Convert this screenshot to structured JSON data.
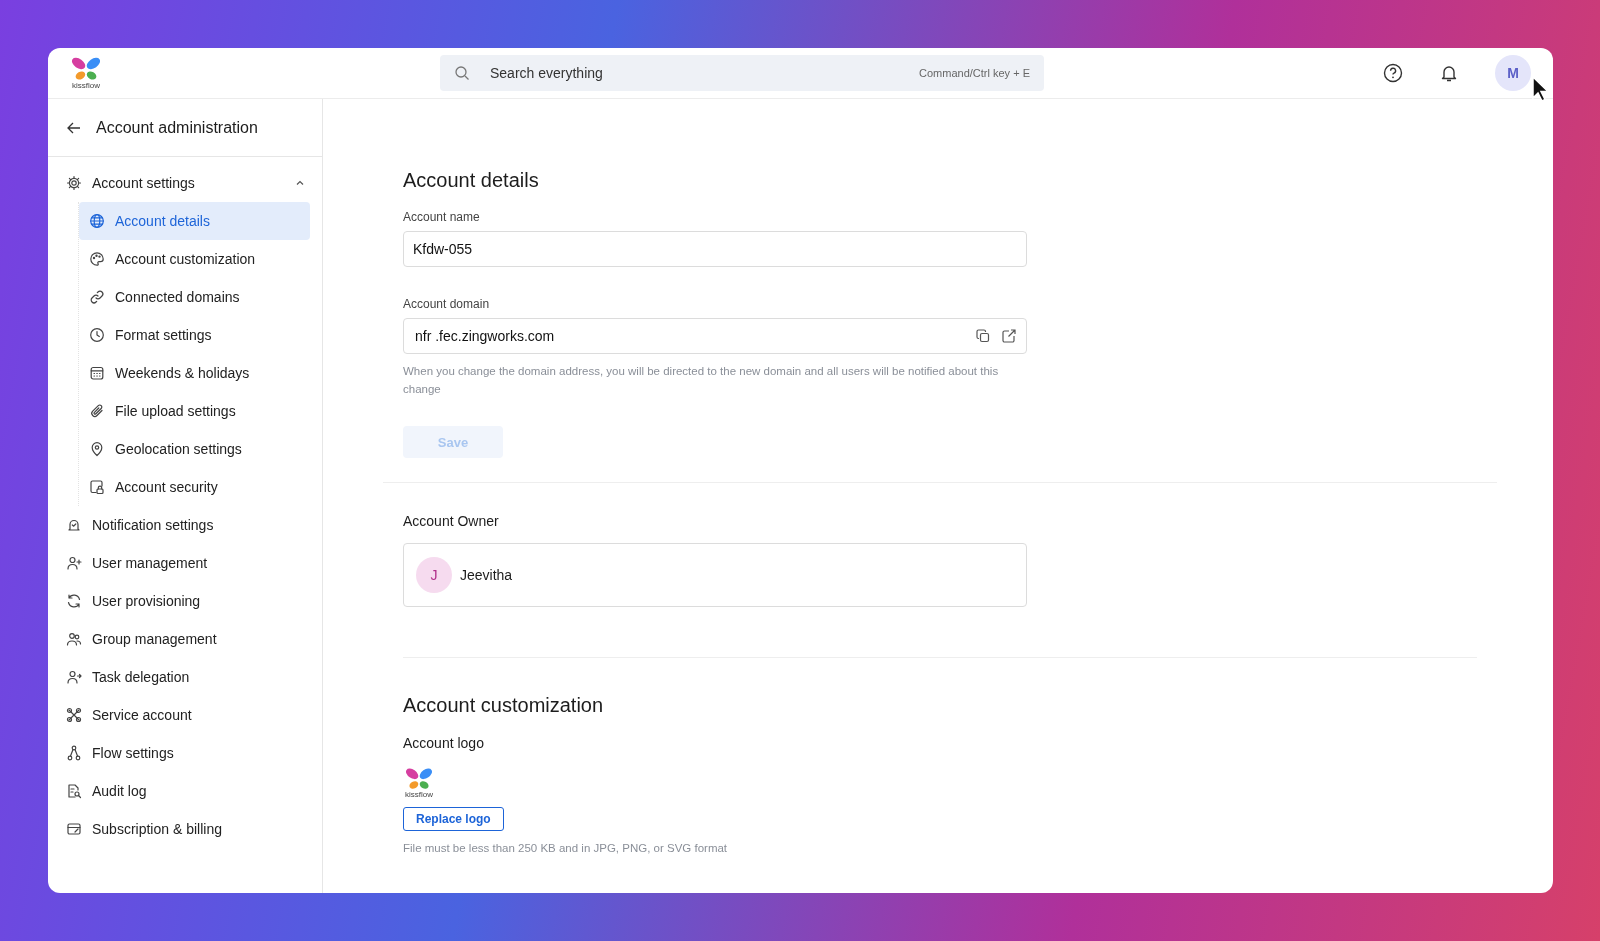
{
  "header": {
    "logo_text": "kissflow",
    "search": {
      "placeholder": "Search everything",
      "shortcut": "Command/Ctrl key + E"
    },
    "avatar": "M"
  },
  "sidebar": {
    "title": "Account administration",
    "items": [
      {
        "label": "Account settings",
        "selected": false,
        "expanded": true,
        "children": [
          {
            "label": "Account details",
            "selected": true
          },
          {
            "label": "Account customization",
            "selected": false
          },
          {
            "label": "Connected domains",
            "selected": false
          },
          {
            "label": "Format settings",
            "selected": false
          },
          {
            "label": "Weekends & holidays",
            "selected": false
          },
          {
            "label": "File upload settings",
            "selected": false
          },
          {
            "label": "Geolocation settings",
            "selected": false
          },
          {
            "label": "Account security",
            "selected": false
          }
        ]
      },
      {
        "label": "Notification settings",
        "selected": false
      },
      {
        "label": "User management",
        "selected": false
      },
      {
        "label": "User provisioning",
        "selected": false
      },
      {
        "label": "Group management",
        "selected": false
      },
      {
        "label": "Task delegation",
        "selected": false
      },
      {
        "label": "Service account",
        "selected": false
      },
      {
        "label": "Flow settings",
        "selected": false
      },
      {
        "label": "Audit log",
        "selected": false
      },
      {
        "label": "Subscription & billing",
        "selected": false
      }
    ]
  },
  "account_details": {
    "title": "Account details",
    "account_name": {
      "label": "Account name",
      "value": "Kfdw-055"
    },
    "account_domain": {
      "label": "Account domain",
      "value": "nfr .fec.zingworks.com",
      "help": "When you change the domain address, you will be directed to the new domain and all users will be notified about this change"
    },
    "save": {
      "label": "Save",
      "disabled": true
    },
    "owner": {
      "label": "Account Owner",
      "initial": "J",
      "name": "Jeevitha"
    }
  },
  "account_customization": {
    "title": "Account customization",
    "logo_label": "Account logo",
    "logo_text": "kissflow",
    "replace_button": "Replace logo",
    "hint": "File must be less than 250 KB and in JPG, PNG, or SVG format"
  }
}
